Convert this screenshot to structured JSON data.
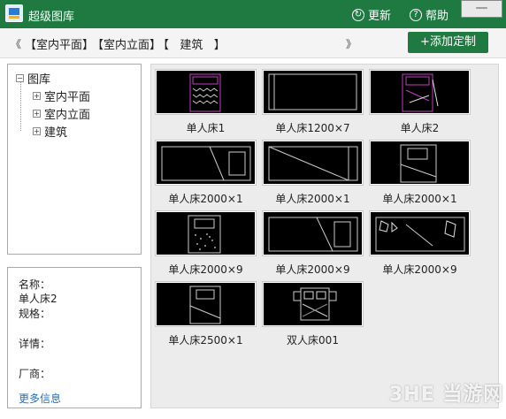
{
  "title": "超级图库",
  "header": {
    "refresh_label": "更新",
    "help_label": "帮助",
    "close_glyph": "—"
  },
  "toolbar": {
    "prev": "《",
    "next": "》",
    "crumbs": [
      "【室内平面】",
      "【室内立面】",
      "【   建筑   】"
    ],
    "add_label": "+添加定制"
  },
  "tree": {
    "root": "图库",
    "children": [
      "室内平面",
      "室内立面",
      "建筑"
    ]
  },
  "info": {
    "name_label": "名称：",
    "name_value": "单人床2",
    "spec_label": "规格：",
    "detail_label": "详情：",
    "vendor_label": "厂商：",
    "more_link": "更多信息"
  },
  "thumbnails": [
    {
      "label": "单人床1"
    },
    {
      "label": "单人床1200×7"
    },
    {
      "label": "单人床2"
    },
    {
      "label": "单人床2000×1"
    },
    {
      "label": "单人床2000×1"
    },
    {
      "label": "单人床2000×1"
    },
    {
      "label": "单人床2000×9"
    },
    {
      "label": "单人床2000×9"
    },
    {
      "label": "单人床2000×9"
    },
    {
      "label": "单人床2500×1"
    },
    {
      "label": "双人床001"
    }
  ],
  "watermark": "3HE 当游网",
  "colors": {
    "accent": "#1e7a40",
    "link": "#1f6fc5",
    "thumb_bg": "#000000",
    "magenta": "#c040c0"
  }
}
